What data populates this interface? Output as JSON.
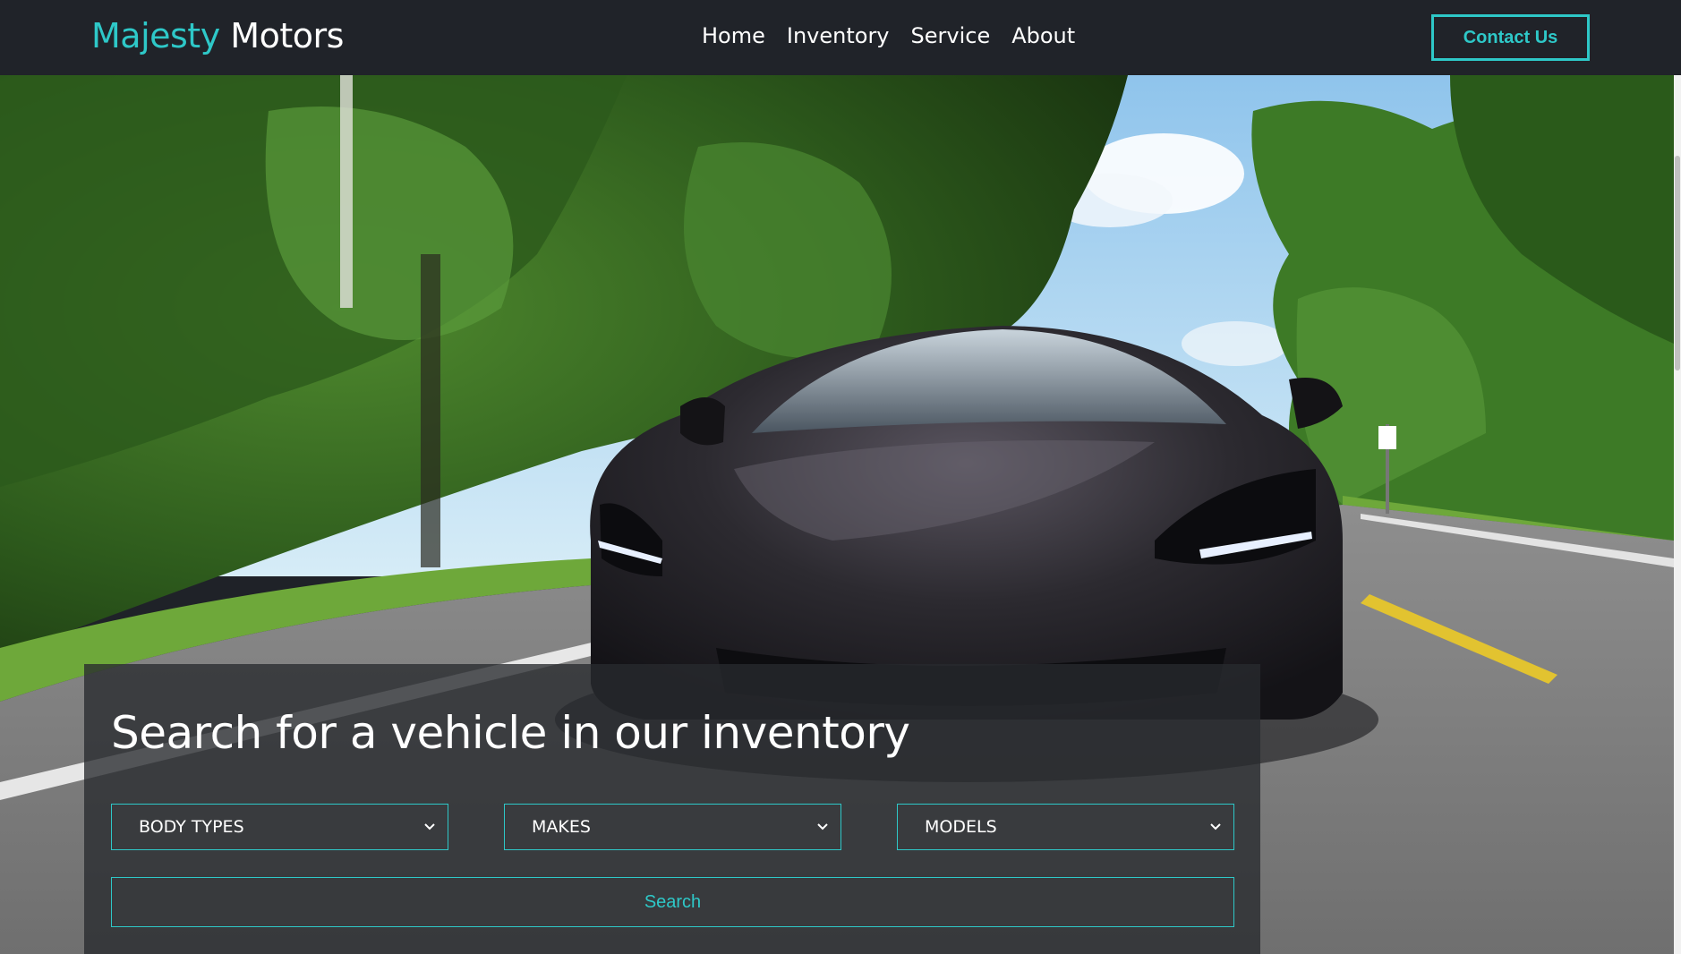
{
  "navbar": {
    "brand_accent": "Majesty",
    "brand_rest": "Motors",
    "links": [
      "Home",
      "Inventory",
      "Service",
      "About"
    ],
    "contact_label": "Contact Us"
  },
  "hero": {
    "image": "black sports car on tree-lined road"
  },
  "search": {
    "title": "Search for a vehicle in our inventory",
    "body_types": "BODY TYPES",
    "makes": "MAKES",
    "models": "MODELS",
    "button_label": "Search"
  },
  "colors": {
    "accent": "#2ec8c8",
    "nav_bg": "#202329"
  }
}
